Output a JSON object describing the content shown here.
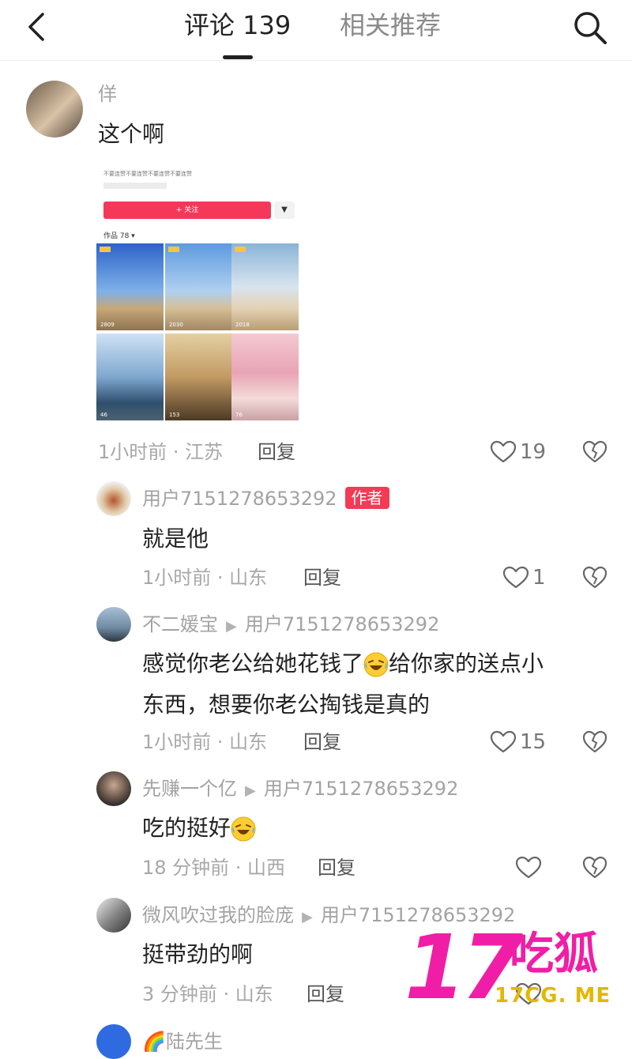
{
  "header": {
    "tab_comments": "评论 139",
    "tab_related": "相关推荐",
    "back_icon": "chevron-left-icon",
    "search_icon": "search-icon"
  },
  "comments": [
    {
      "user": "佯",
      "text": "这个啊",
      "time_location": "1小时前 · 江苏",
      "reply_label": "回复",
      "likes": "19",
      "embedded_screenshot": {
        "bio": "不要连赞不要连赞不要连赞不要连赞",
        "follow_label": "+ 关注",
        "works_label": "作品 78 ▾",
        "thumb_counts": [
          "2809",
          "2030",
          "2018",
          "46",
          "153",
          "76"
        ]
      }
    },
    {
      "user": "用户7151278653292",
      "badge": "作者",
      "text": "就是他",
      "time_location": "1小时前 · 山东",
      "reply_label": "回复",
      "likes": "1"
    },
    {
      "user": "不二媛宝",
      "reply_to": "用户7151278653292",
      "text_part1": "感觉你老公给她花钱了",
      "text_part2": "给你家的送点小",
      "text_line2": "东西，想要你老公掏钱是真的",
      "time_location": "1小时前 · 山东",
      "reply_label": "回复",
      "likes": "15"
    },
    {
      "user": "先赚一个亿",
      "reply_to": "用户7151278653292",
      "text": "吃的挺好",
      "time_location": "18 分钟前 · 山西",
      "reply_label": "回复",
      "likes": ""
    },
    {
      "user": "微风吹过我的脸庞",
      "reply_to": "用户7151278653292",
      "text": "挺带劲的啊",
      "time_location": "3 分钟前 · 山东",
      "reply_label": "回复",
      "likes": ""
    },
    {
      "user": "🌈陆先生"
    }
  ],
  "watermark": {
    "number": "17",
    "brand": "吃狐",
    "url": "17CG. ME"
  },
  "colors": {
    "accent": "#f23b55",
    "watermark_pink": "#f01ea6",
    "watermark_yellow": "#e2b800"
  }
}
